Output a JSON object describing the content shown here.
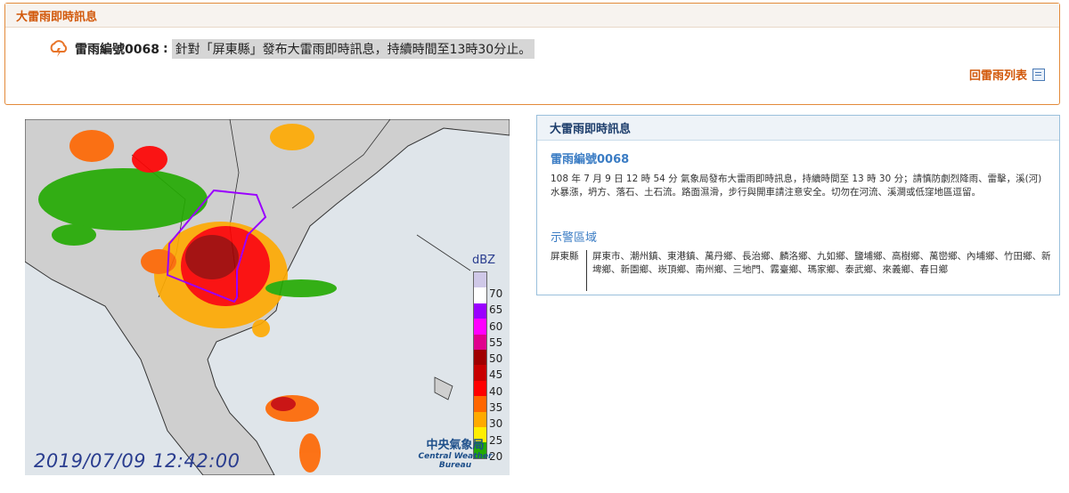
{
  "top": {
    "header": "大雷雨即時訊息",
    "alert_id": "雷雨編號0068",
    "colon": ":",
    "message": "針對「屏東縣」發布大雷雨即時訊息，持續時間至13時30分止。",
    "back_link": "回雷雨列表"
  },
  "map": {
    "timestamp": "2019/07/09 12:42:00",
    "bureau_zh": "中央氣象局",
    "bureau_en": "Central Weather Bureau",
    "legend_title": "dBZ",
    "legend": [
      {
        "label": "",
        "color": "#cfc8e8"
      },
      {
        "label": "70",
        "color": "#ffffff"
      },
      {
        "label": "65",
        "color": "#9a00ff"
      },
      {
        "label": "60",
        "color": "#ff00ff"
      },
      {
        "label": "55",
        "color": "#e0008e"
      },
      {
        "label": "50",
        "color": "#a00000"
      },
      {
        "label": "45",
        "color": "#c80000"
      },
      {
        "label": "40",
        "color": "#ff0000"
      },
      {
        "label": "35",
        "color": "#ff6600"
      },
      {
        "label": "30",
        "color": "#ffaa00"
      },
      {
        "label": "25",
        "color": "#ffee00"
      },
      {
        "label": "20",
        "color": "#22aa00"
      }
    ]
  },
  "info": {
    "header": "大雷雨即時訊息",
    "id": "雷雨編號0068",
    "description": "108 年 7 月 9 日 12 時 54 分 氣象局發布大雷雨即時訊息，持續時間至 13 時 30 分；請慎防劇烈降雨、雷擊，溪(河)水暴漲，坍方、落石、土石流。路面濕滑，步行與開車請注意安全。切勿在河流、溪澗或低窪地區逗留。",
    "warning_title": "示警區域",
    "county": "屏東縣",
    "towns": "屏東市、潮州鎮、東港鎮、萬丹鄉、長治鄉、麟洛鄉、九如鄉、鹽埔鄉、高樹鄉、萬巒鄉、內埔鄉、竹田鄉、新埤鄉、新園鄉、崁頂鄉、南州鄉、三地門、霧臺鄉、瑪家鄉、泰武鄉、來義鄉、春日鄉"
  },
  "colors": {
    "accent_orange": "#d2580a",
    "accent_blue": "#3a7cc4",
    "polygon": "#9a00ff"
  }
}
